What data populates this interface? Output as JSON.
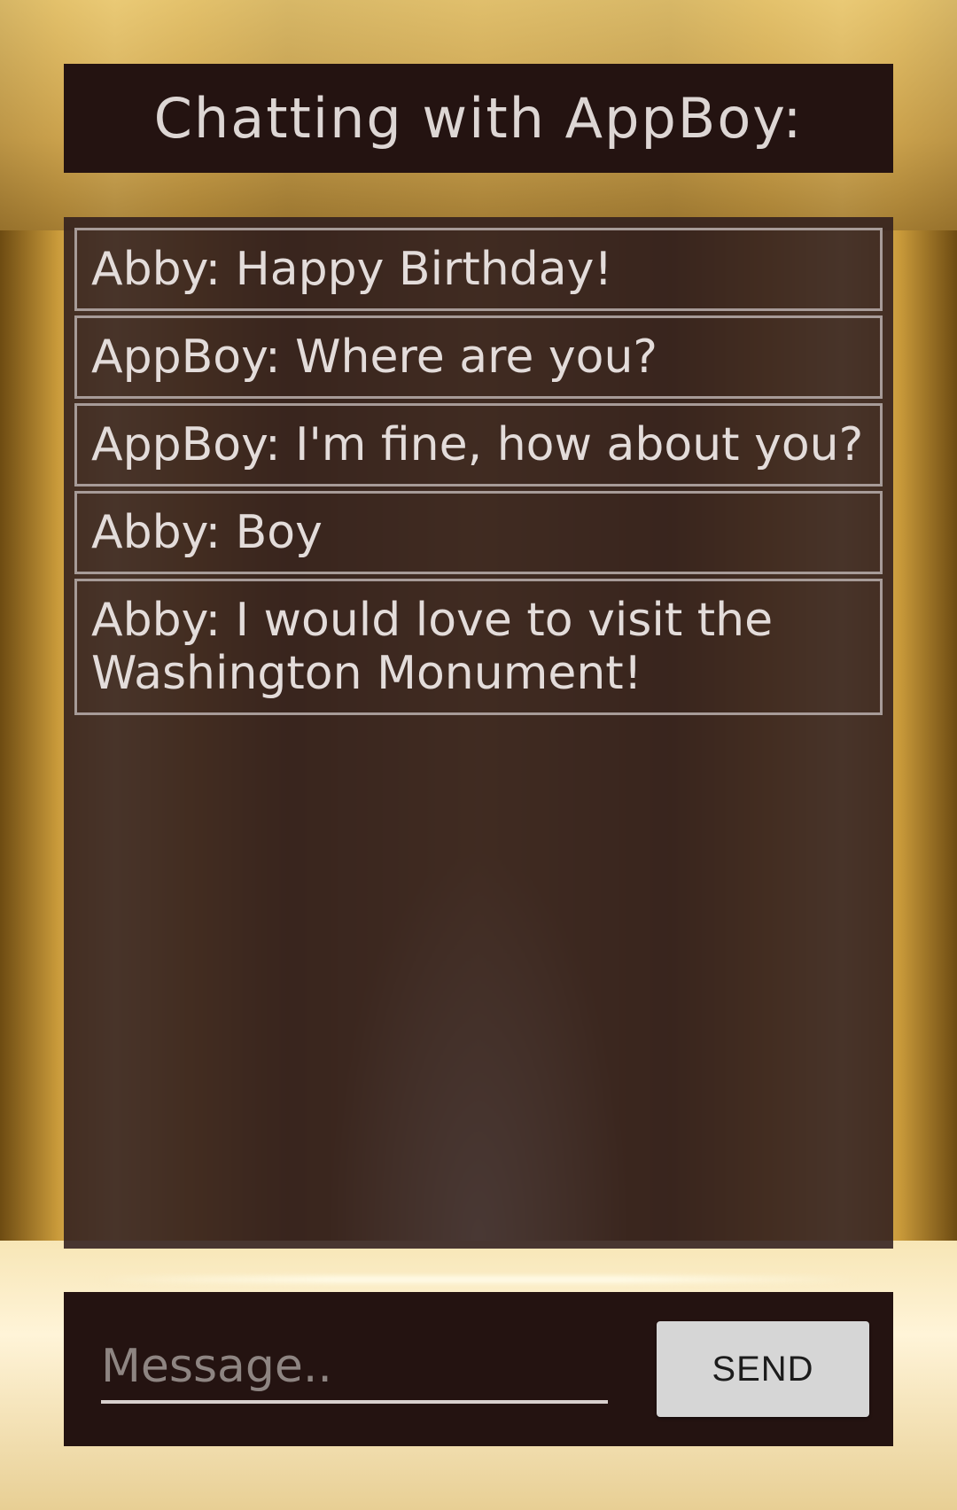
{
  "header": {
    "title": "Chatting with AppBoy:"
  },
  "messages": [
    {
      "text": "Abby: Happy Birthday!"
    },
    {
      "text": "AppBoy: Where are you?"
    },
    {
      "text": "AppBoy: I'm fine, how about you?"
    },
    {
      "text": "Abby: Boy"
    },
    {
      "text": "Abby: I would love to visit the Washington Monument!"
    }
  ],
  "composer": {
    "input_value": "",
    "placeholder": "Message..",
    "send_label": "SEND"
  },
  "colors": {
    "panel": "#241311",
    "chat_overlay": "#301e1e",
    "text": "#e3dcda",
    "button": "#d6d6d6"
  }
}
